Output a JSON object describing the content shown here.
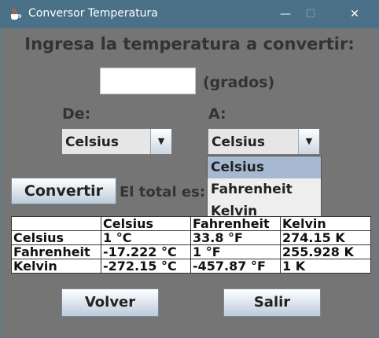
{
  "window": {
    "title": "Conversor Temperatura",
    "minimize": "—",
    "maximize": "☐",
    "close": "✕"
  },
  "heading": "Ingresa la temperatura a convertir:",
  "input": {
    "value": "",
    "unit_label": "(grados)"
  },
  "from": {
    "label": "De:",
    "selected": "Celsius"
  },
  "to": {
    "label": "A:",
    "selected": "Celsius",
    "options": [
      "Celsius",
      "Fahrenheit",
      "Kelvin"
    ],
    "highlighted": "Celsius"
  },
  "convert_button": "Convertir",
  "total_label": "El total es:",
  "table": {
    "headers": [
      "",
      "Celsius",
      "Fahrenheit",
      "Kelvin"
    ],
    "rows": [
      [
        "Celsius",
        "1 °C",
        "33.8 °F",
        "274.15 K"
      ],
      [
        "Fahrenheit",
        "-17.222 °C",
        "1 °F",
        "255.928 K"
      ],
      [
        "Kelvin",
        "-272.15 °C",
        "-457.87 °F",
        "1 K"
      ]
    ]
  },
  "back_button": "Volver",
  "exit_button": "Salir"
}
